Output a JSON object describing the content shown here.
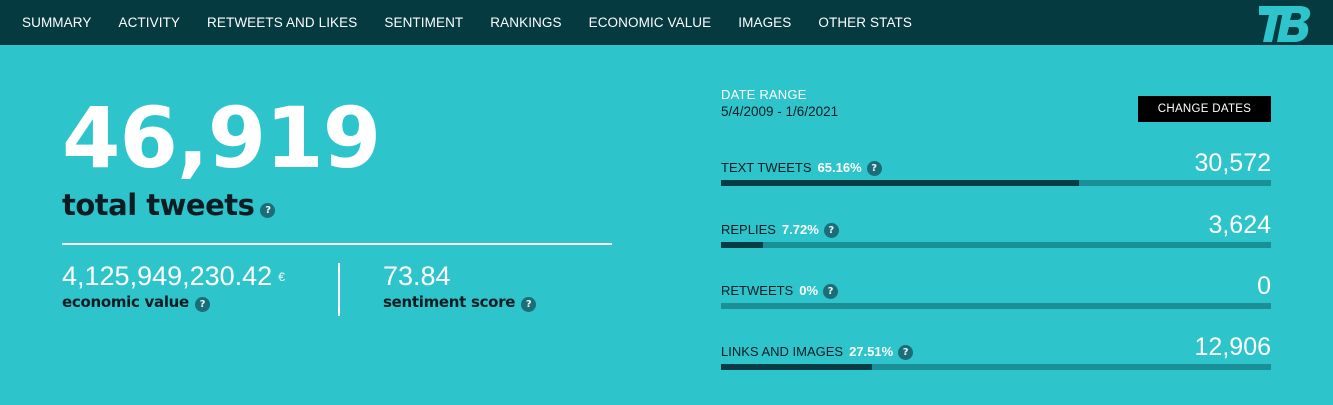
{
  "nav": {
    "items": [
      {
        "label": "SUMMARY"
      },
      {
        "label": "ACTIVITY"
      },
      {
        "label": "RETWEETS AND LIKES"
      },
      {
        "label": "SENTIMENT"
      },
      {
        "label": "RANKINGS"
      },
      {
        "label": "ECONOMIC VALUE"
      },
      {
        "label": "IMAGES"
      },
      {
        "label": "OTHER STATS"
      }
    ],
    "logo_icon": "tb-logo-icon"
  },
  "summary": {
    "total_tweets": "46,919",
    "total_tweets_label": "total tweets",
    "economic_value": "4,125,949,230.42",
    "currency": "€",
    "economic_value_label": "economic value",
    "sentiment_score": "73.84",
    "sentiment_score_label": "sentiment score",
    "help_glyph": "?"
  },
  "date_range": {
    "label": "DATE RANGE",
    "value": "5/4/2009 - 1/6/2021",
    "button_label": "CHANGE DATES"
  },
  "breakdown": [
    {
      "label": "TEXT TWEETS",
      "percent": "65.16%",
      "count": "30,572",
      "fraction": 0.6516
    },
    {
      "label": "REPLIES",
      "percent": "7.72%",
      "count": "3,624",
      "fraction": 0.0772
    },
    {
      "label": "RETWEETS",
      "percent": "0%",
      "count": "0",
      "fraction": 0
    },
    {
      "label": "LINKS AND IMAGES",
      "percent": "27.51%",
      "count": "12,906",
      "fraction": 0.2751
    }
  ],
  "colors": {
    "background": "#2ec4cb",
    "nav": "#043a40",
    "bar_track": "#1a8f97",
    "bar_fill": "#063d44"
  }
}
